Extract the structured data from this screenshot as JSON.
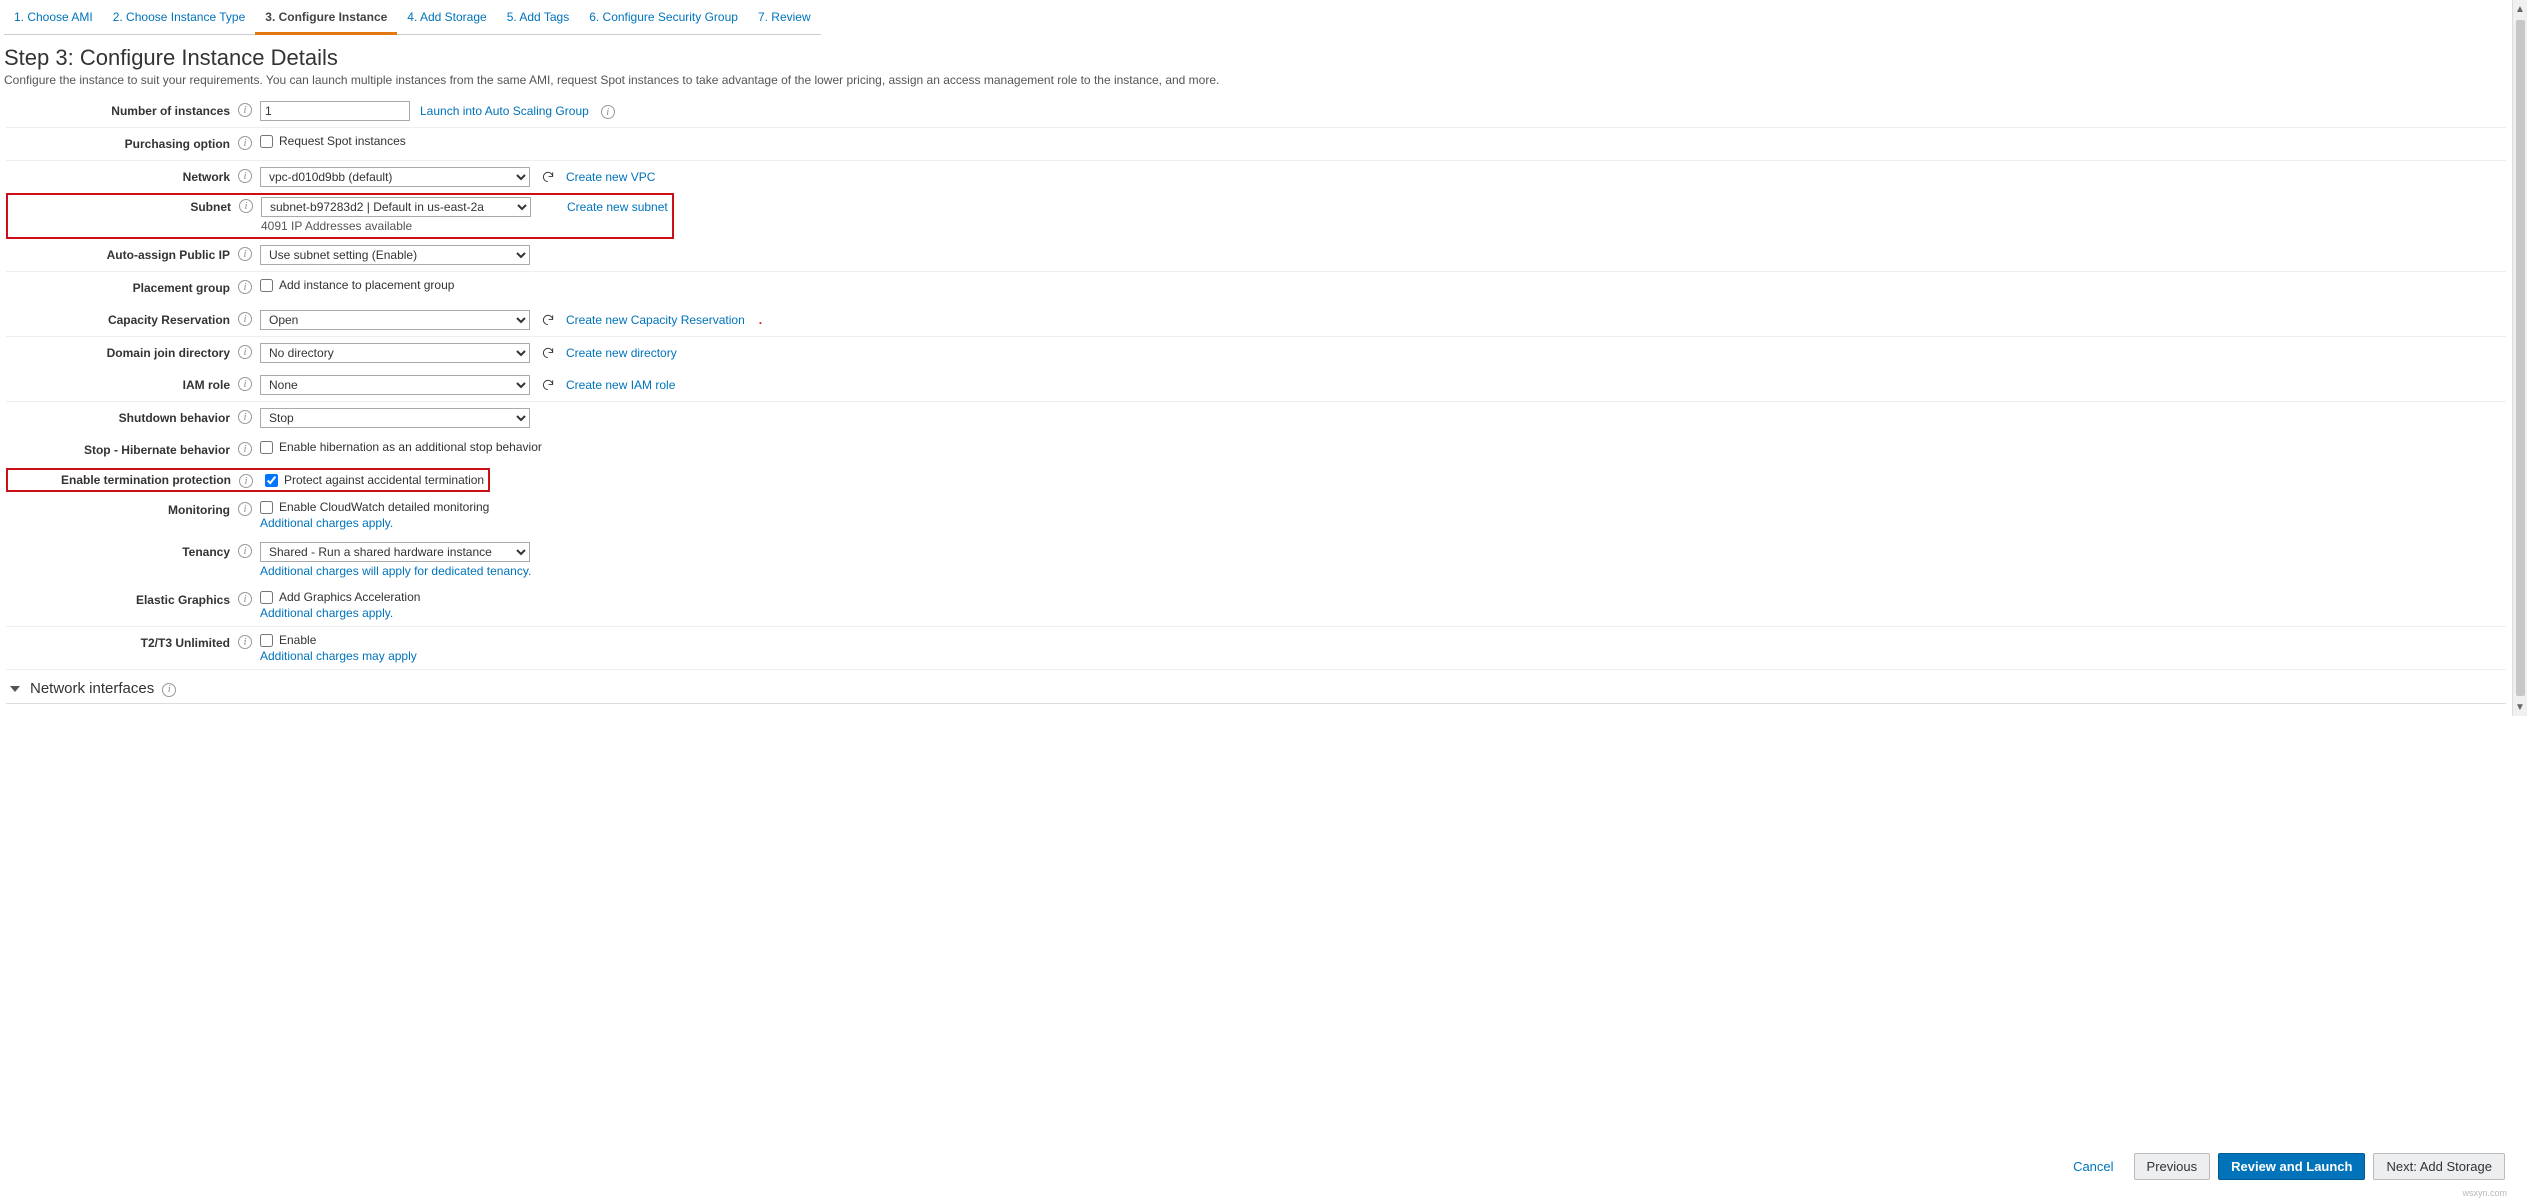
{
  "wizard": {
    "tabs": [
      {
        "label": "1. Choose AMI"
      },
      {
        "label": "2. Choose Instance Type"
      },
      {
        "label": "3. Configure Instance"
      },
      {
        "label": "4. Add Storage"
      },
      {
        "label": "5. Add Tags"
      },
      {
        "label": "6. Configure Security Group"
      },
      {
        "label": "7. Review"
      }
    ],
    "active_index": 2
  },
  "page": {
    "title": "Step 3: Configure Instance Details",
    "description": "Configure the instance to suit your requirements. You can launch multiple instances from the same AMI, request Spot instances to take advantage of the lower pricing, assign an access management role to the instance, and more."
  },
  "form": {
    "instances": {
      "label": "Number of instances",
      "value": "1",
      "asg_link": "Launch into Auto Scaling Group"
    },
    "purchasing": {
      "label": "Purchasing option",
      "checkbox": "Request Spot instances"
    },
    "network": {
      "label": "Network",
      "value": "vpc-d010d9bb (default)",
      "create_link": "Create new VPC"
    },
    "subnet": {
      "label": "Subnet",
      "value": "subnet-b97283d2 | Default in us-east-2a",
      "ip_text": "4091 IP Addresses available",
      "create_link": "Create new subnet"
    },
    "auto_ip": {
      "label": "Auto-assign Public IP",
      "value": "Use subnet setting (Enable)"
    },
    "placement": {
      "label": "Placement group",
      "checkbox": "Add instance to placement group"
    },
    "capacity": {
      "label": "Capacity Reservation",
      "value": "Open",
      "create_link": "Create new Capacity Reservation"
    },
    "domain_dir": {
      "label": "Domain join directory",
      "value": "No directory",
      "create_link": "Create new directory"
    },
    "iam": {
      "label": "IAM role",
      "value": "None",
      "create_link": "Create new IAM role"
    },
    "shutdown": {
      "label": "Shutdown behavior",
      "value": "Stop"
    },
    "hibernate": {
      "label": "Stop - Hibernate behavior",
      "checkbox": "Enable hibernation as an additional stop behavior"
    },
    "term_protect": {
      "label": "Enable termination protection",
      "checkbox": "Protect against accidental termination"
    },
    "monitoring": {
      "label": "Monitoring",
      "checkbox": "Enable CloudWatch detailed monitoring",
      "sub": "Additional charges apply."
    },
    "tenancy": {
      "label": "Tenancy",
      "value": "Shared - Run a shared hardware instance",
      "sub": "Additional charges will apply for dedicated tenancy."
    },
    "elastic_gpu": {
      "label": "Elastic Graphics",
      "checkbox": "Add Graphics Acceleration",
      "sub": "Additional charges apply."
    },
    "t_unlimited": {
      "label": "T2/T3 Unlimited",
      "checkbox": "Enable",
      "sub": "Additional charges may apply"
    }
  },
  "section": {
    "network_interfaces": "Network interfaces"
  },
  "footer": {
    "cancel": "Cancel",
    "previous": "Previous",
    "review": "Review and Launch",
    "next": "Next: Add Storage"
  },
  "watermark": "wsxyn.com"
}
